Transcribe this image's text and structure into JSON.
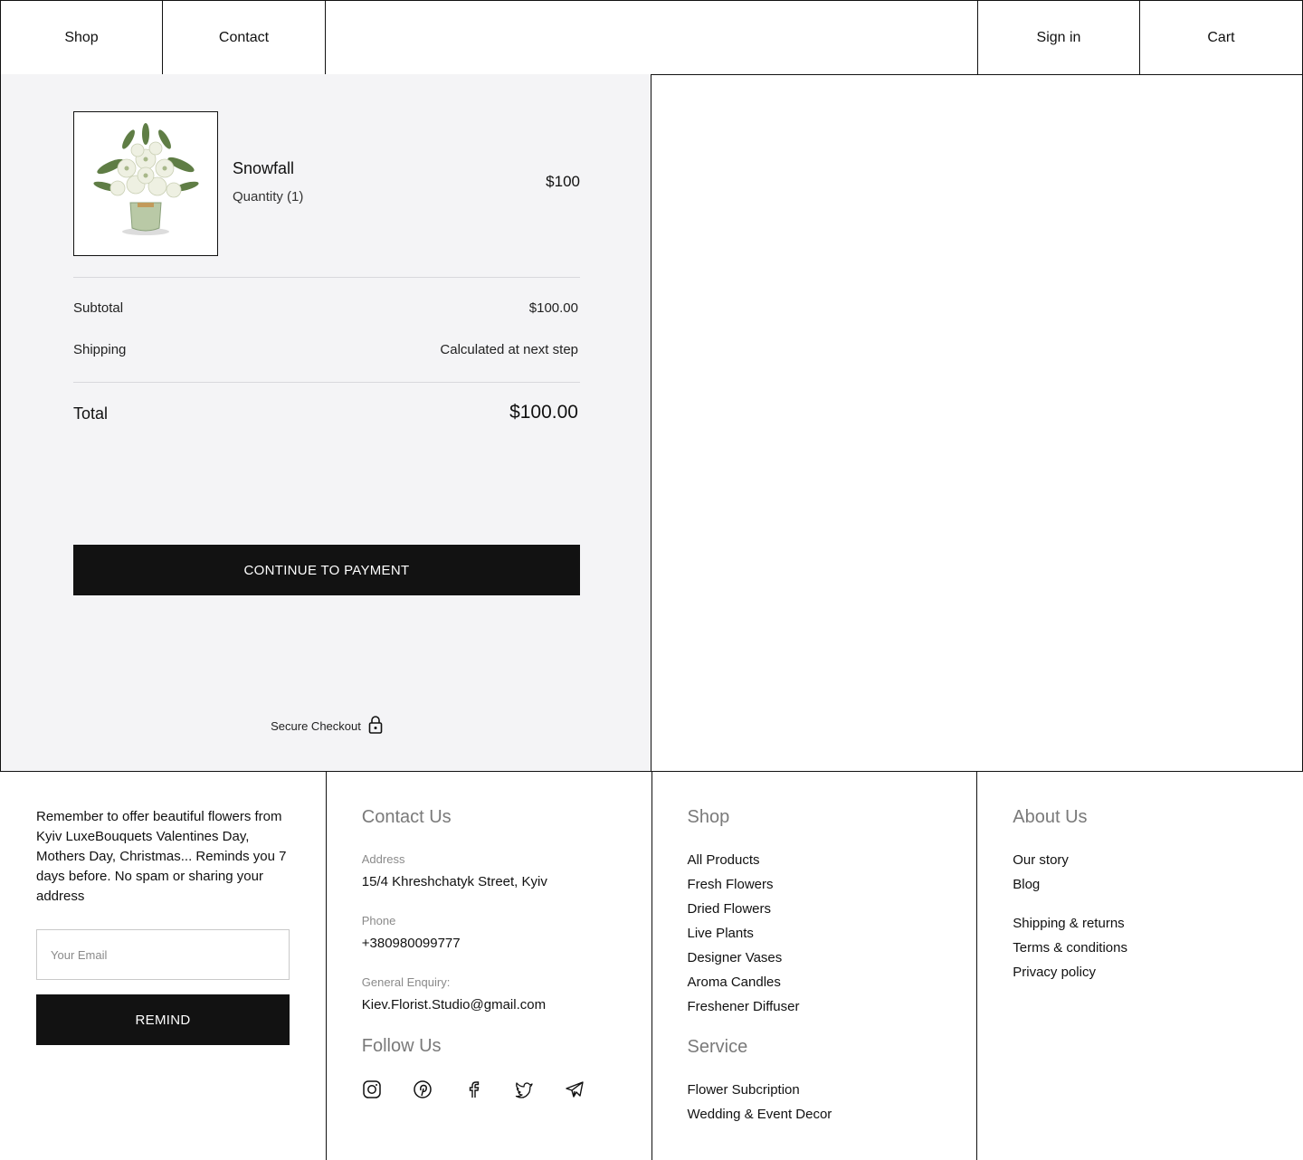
{
  "nav": {
    "shop": "Shop",
    "contact": "Contact",
    "sign_in": "Sign in",
    "cart": "Cart"
  },
  "order": {
    "item": {
      "name": "Snowfall",
      "quantity": "Quantity (1)",
      "price": "$100",
      "image_icon": "flower-bouquet-image"
    },
    "subtotal_label": "Subtotal",
    "subtotal_value": "$100.00",
    "shipping_label": "Shipping",
    "shipping_value": "Calculated at next step",
    "total_label": "Total",
    "total_value": "$100.00",
    "continue_button": "CONTINUE TO PAYMENT",
    "secure_label": "Secure Checkout",
    "secure_icon": "lock-icon"
  },
  "footer": {
    "remind": {
      "text": "Remember to offer beautiful flowers from Kyiv LuxeBouquets Valentines Day, Mothers Day, Christmas... Reminds you 7 days before. No spam or sharing your address",
      "email_placeholder": "Your Email",
      "button": "REMIND"
    },
    "contact": {
      "heading": "Contact Us",
      "address_label": "Address",
      "address_value": "15/4 Khreshchatyk Street, Kyiv",
      "phone_label": "Phone",
      "phone_value": "+380980099777",
      "enquiry_label": "General Enquiry:",
      "enquiry_value": "Kiev.Florist.Studio@gmail.com",
      "follow_heading": "Follow Us",
      "social_icons": [
        "instagram-icon",
        "pinterest-icon",
        "facebook-icon",
        "twitter-icon",
        "telegram-icon"
      ]
    },
    "shop": {
      "heading": "Shop",
      "items": [
        "All Products",
        "Fresh Flowers",
        "Dried Flowers",
        "Live Plants",
        "Designer Vases",
        "Aroma Candles",
        "Freshener Diffuser"
      ],
      "service_heading": "Service",
      "service_items": [
        "Flower Subcription",
        "Wedding & Event Decor"
      ]
    },
    "about": {
      "heading": "About Us",
      "items": [
        "Our story",
        "Blog"
      ],
      "policy_items": [
        "Shipping & returns",
        "Terms & conditions",
        "Privacy policy"
      ]
    }
  },
  "colors": {
    "panel_bg": "#f4f4f6",
    "button_bg": "#121212",
    "border": "#111111",
    "muted_heading": "#7a7a7a"
  }
}
